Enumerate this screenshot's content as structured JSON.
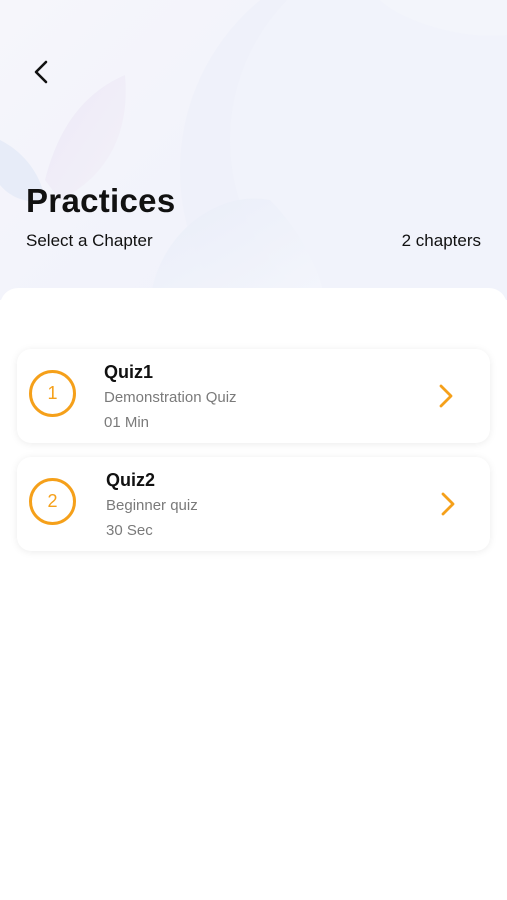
{
  "header": {
    "back_icon": "chevron-left-icon",
    "title": "Practices",
    "subtitle": "Select a Chapter",
    "chapter_count": "2 chapters"
  },
  "colors": {
    "accent": "#f5a01a",
    "muted_text": "#7a7a7a",
    "header_background": "#f2f3fb"
  },
  "quizzes": [
    {
      "number": "1",
      "title": "Quiz1",
      "description": "Demonstration Quiz",
      "duration": "01 Min",
      "arrow_icon": "chevron-right-icon"
    },
    {
      "number": "2",
      "title": "Quiz2",
      "description": "Beginner quiz",
      "duration": "30 Sec",
      "arrow_icon": "chevron-right-icon"
    }
  ]
}
